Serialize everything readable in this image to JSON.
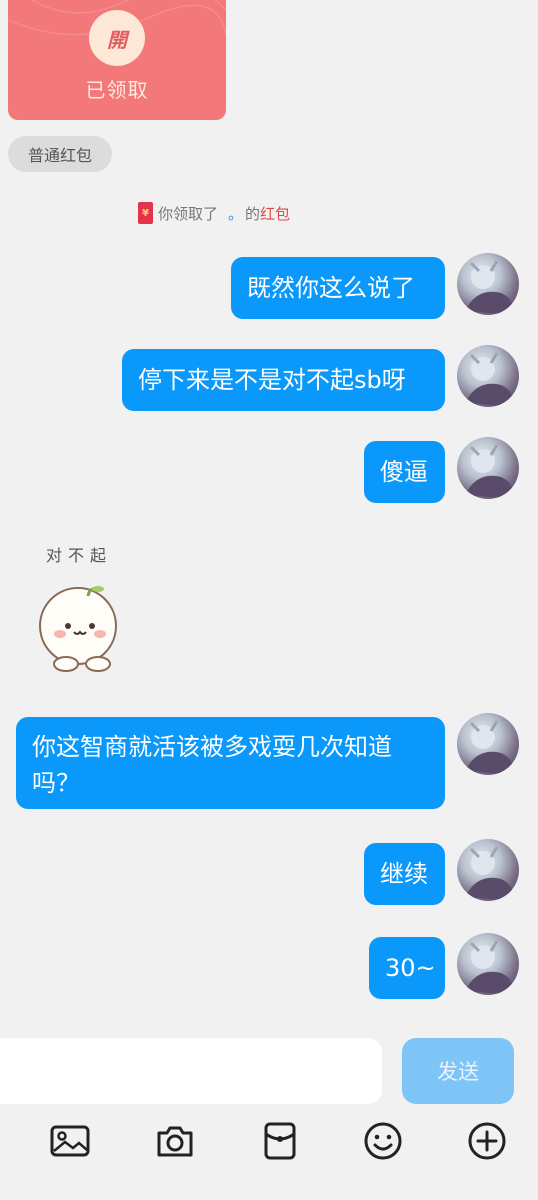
{
  "red_envelope": {
    "open_char": "開",
    "status": "已领取",
    "type_label": "普通红包"
  },
  "notice": {
    "prefix": "你领取了",
    "name": "。",
    "possessive": "的",
    "link": "红包"
  },
  "messages": [
    {
      "id": "m1",
      "text": "既然你这么说了"
    },
    {
      "id": "m2",
      "text": "停下来是不是对不起sb呀"
    },
    {
      "id": "m3",
      "text": "傻逼"
    },
    {
      "id": "m4",
      "text": "你这智商就活该被多戏耍几次知道吗？"
    },
    {
      "id": "m5",
      "text": "继续"
    },
    {
      "id": "m6",
      "text": "30~"
    }
  ],
  "sticker": {
    "caption": "对不起"
  },
  "composer": {
    "send_label": "发送"
  },
  "toolbar": {
    "icons": [
      "image-icon",
      "camera-icon",
      "red-envelope-icon",
      "emoji-icon",
      "plus-icon"
    ]
  },
  "colors": {
    "bubble": "#0a98fb",
    "envelope": "#f3787a",
    "send_disabled": "#7ec4f6",
    "background": "#f1f1f1"
  }
}
